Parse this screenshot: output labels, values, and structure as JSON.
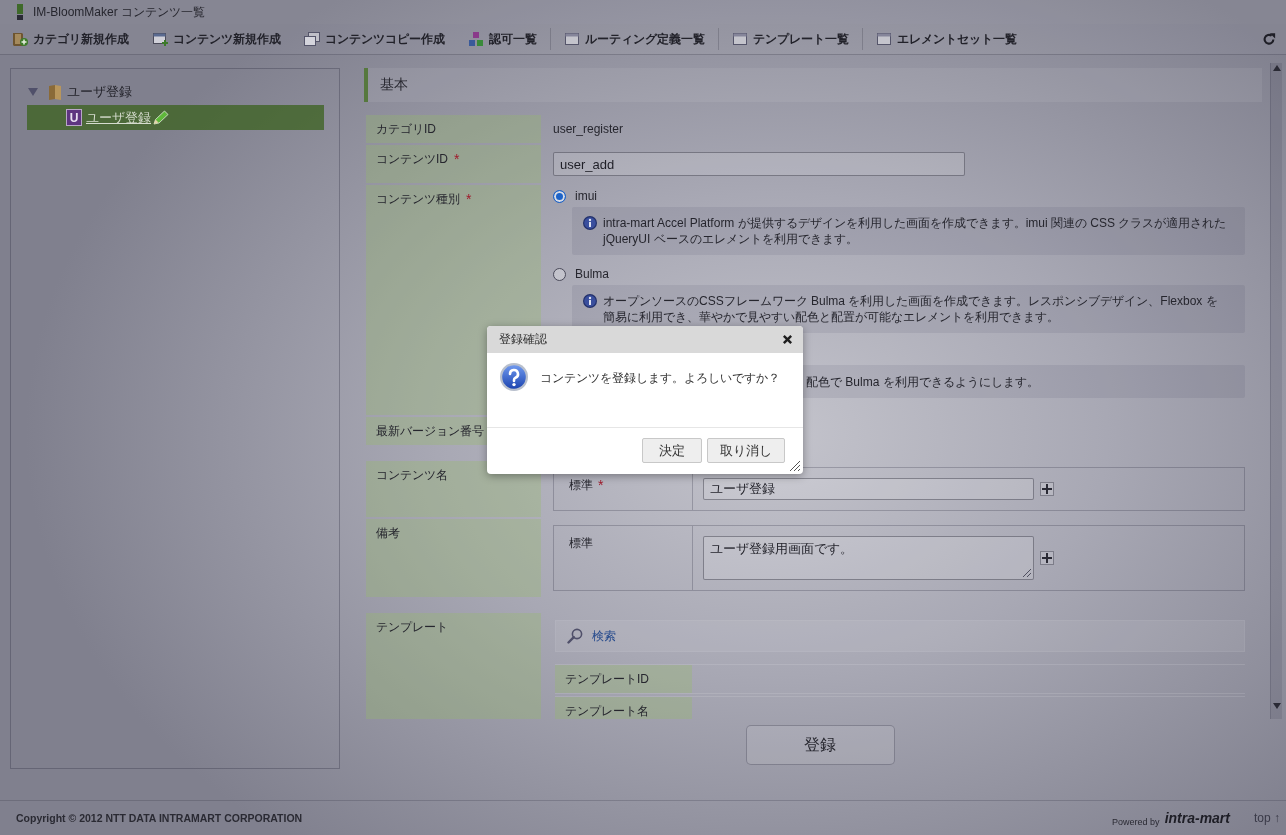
{
  "window": {
    "title": "IM-BloomMaker コンテンツ一覧"
  },
  "toolbar": {
    "groups": [
      [
        "カテゴリ新規作成",
        "コンテンツ新規作成",
        "コンテンツコピー作成",
        "認可一覧"
      ],
      [
        "ルーティング定義一覧"
      ],
      [
        "テンプレート一覧"
      ],
      [
        "エレメントセット一覧"
      ]
    ]
  },
  "tree": [
    {
      "label": "ユーザ登録",
      "expanded": true,
      "selected": false,
      "children": [
        {
          "type_badge": "U",
          "label": "ユーザ登録",
          "selected": true
        }
      ]
    }
  ],
  "section": {
    "title": "基本"
  },
  "form": {
    "tables": [
      {
        "rows": [
          {
            "kind": "text",
            "label": "カテゴリID",
            "value": "user_register"
          },
          {
            "kind": "input",
            "label": "コンテンツID",
            "required_mark": "*",
            "value": "user_add"
          },
          {
            "kind": "radios",
            "label": "コンテンツ種別",
            "required_mark": "*",
            "options": [
              {
                "kind": "radio",
                "label": "imui",
                "selected": true,
                "description": "intra-mart Accel Platform が提供するデザインを利用した画面を作成できます。imui 関連の CSS クラスが適用された jQueryUI ベースのエレメントを利用できます。"
              },
              {
                "kind": "radio",
                "label": "Bulma",
                "selected": false,
                "description": "オープンソースのCSSフレームワーク Bulma を利用した画面を作成できます。レスポンシブデザイン、Flexbox を簡易に利用でき、華やかで見やすい配色と配置が可能なエレメントを利用できます。"
              },
              {
                "kind": "note",
                "description": "配色で Bulma を利用できるようにします。"
              }
            ]
          },
          {
            "kind": "text",
            "label": "最新バージョン番号"
          }
        ]
      },
      {
        "rows": [
          {
            "kind": "locale_input",
            "label": "コンテンツ名",
            "entries": [
              {
                "locale": "標準",
                "required_mark": "*",
                "value": "ユーザ登録"
              }
            ]
          },
          {
            "kind": "locale_textarea",
            "label": "備考",
            "entries": [
              {
                "locale": "標準",
                "value": "ユーザ登録用画面です。"
              }
            ]
          }
        ]
      },
      {
        "rows": [
          {
            "kind": "template",
            "label": "テンプレート",
            "search_link": "検索",
            "columns": [
              "テンプレートID",
              "テンプレート名"
            ]
          }
        ]
      }
    ]
  },
  "submit_button": "登録",
  "footer": {
    "copyright": "Copyright © 2012 NTT DATA INTRAMART CORPORATION",
    "powered_by": "Powered by",
    "logo": "intra-mart",
    "top_link": "top ↑"
  },
  "dialog": {
    "title": "登録確認",
    "message": "コンテンツを登録します。よろしいですか？",
    "buttons": [
      "決定",
      "取り消し"
    ]
  }
}
